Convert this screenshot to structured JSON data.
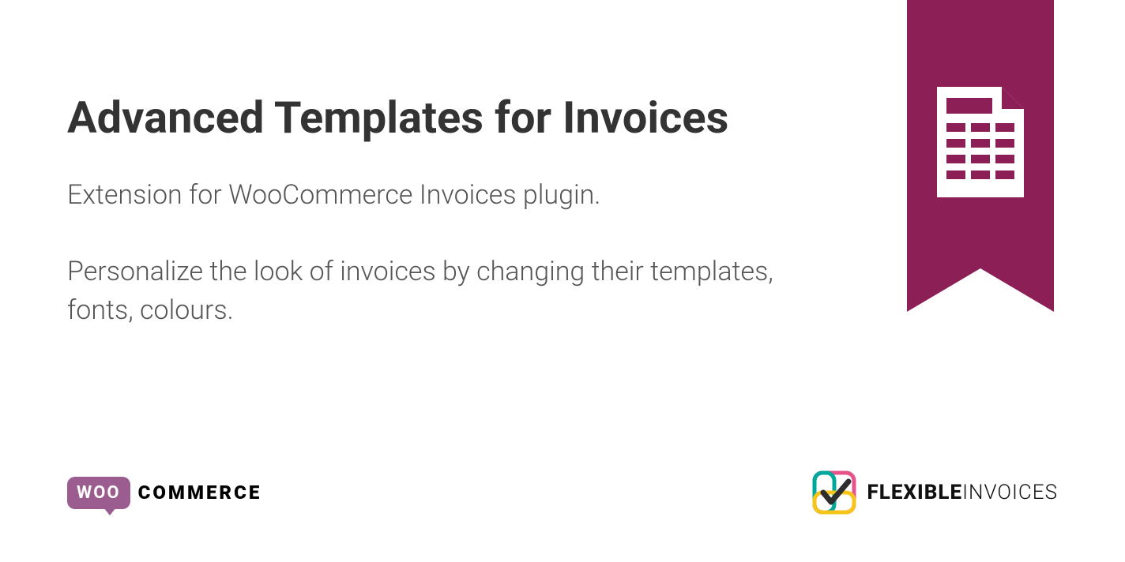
{
  "title": "Advanced Templates for Invoices",
  "description": {
    "line1": "Extension for WooCommerce Invoices plugin.",
    "line2": "Personalize the look of invoices by changing their templates, fonts, colours."
  },
  "woo": {
    "bubble": "WOO",
    "commerce": "COMMERCE"
  },
  "flexible": {
    "bold": "FLEXIBLE",
    "light": "INVOICES"
  },
  "colors": {
    "ribbon": "#8d1f57",
    "wooPurple": "#9b5c8f"
  }
}
